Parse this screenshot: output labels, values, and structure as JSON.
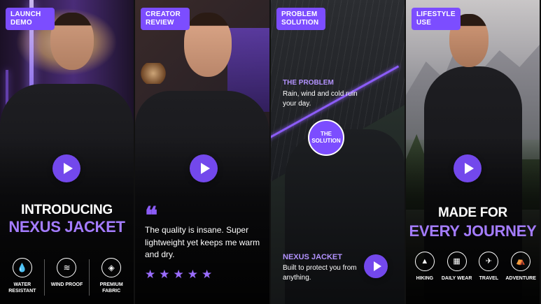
{
  "panels": {
    "launch": {
      "badge": "Launch Demo",
      "heading_white": "INTRODUCING",
      "heading_purple": "NEXUS JACKET",
      "features": [
        {
          "label": "Water Resistant",
          "icon": "water-drop-icon",
          "glyph": "💧"
        },
        {
          "label": "Wind Proof",
          "icon": "wind-icon",
          "glyph": "≋"
        },
        {
          "label": "Premium Fabric",
          "icon": "layers-icon",
          "glyph": "◈"
        }
      ]
    },
    "review": {
      "badge": "Creator Review",
      "quote_mark": "❝",
      "quote": "The quality is insane. Super lightweight yet keeps me warm and dry.",
      "stars": [
        "★",
        "★",
        "★",
        "★",
        "★"
      ]
    },
    "problem": {
      "badge": "Problem Solution",
      "problem_title": "THE PROBLEM",
      "problem_text": "Rain, wind and cold ruin your day.",
      "solution_badge": "The Solution",
      "product_title": "NEXUS JACKET",
      "product_text": "Built to protect you from anything."
    },
    "lifestyle": {
      "badge": "Lifestyle Use",
      "heading_white": "MADE FOR",
      "heading_purple": "EVERY JOURNEY",
      "features": [
        {
          "label": "Hiking",
          "icon": "mountain-icon",
          "glyph": "▲"
        },
        {
          "label": "Daily Wear",
          "icon": "building-icon",
          "glyph": "▦"
        },
        {
          "label": "Travel",
          "icon": "airplane-icon",
          "glyph": "✈"
        },
        {
          "label": "Adventure",
          "icon": "tent-icon",
          "glyph": "⛺"
        }
      ]
    }
  },
  "colors": {
    "accent": "#7c4dff",
    "accent_text": "#a47cff",
    "star": "#9b6dff"
  }
}
